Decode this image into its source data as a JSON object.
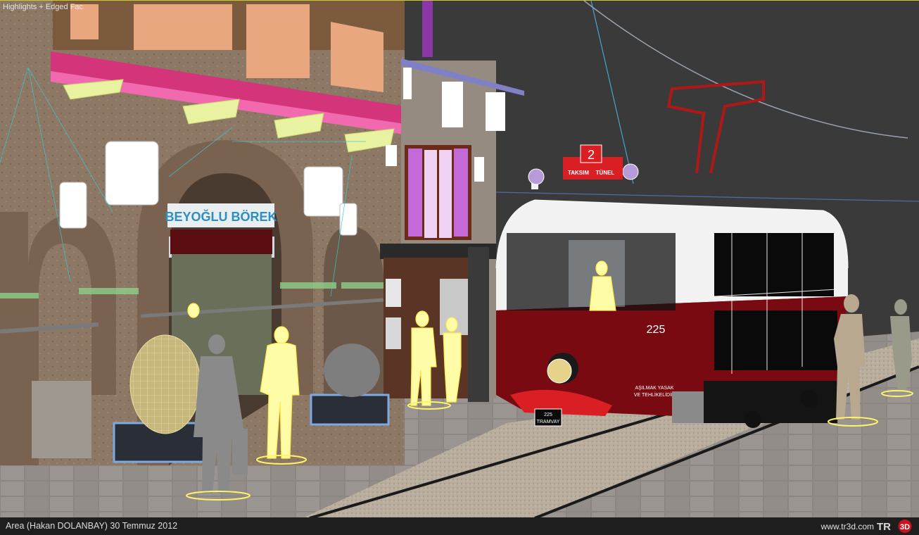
{
  "viewport": {
    "label": "Highlights + Edged Fac",
    "scene": {
      "shop_sign": "BEYOĞLU BÖREK",
      "tram_route_number": "2",
      "tram_destinations": [
        "TAKSIM",
        "TÜNEL"
      ],
      "tram_number": "225",
      "tram_front_plate": [
        "225",
        "TRAMVAY"
      ],
      "tram_warning": [
        "AŞILMAK YASAK",
        "VE TEHLİKELİDİR"
      ]
    },
    "colors": {
      "background": "#3a3a3a",
      "tram_body": "#7a0a12",
      "tram_roof": "#f2f2f2",
      "selection_yellow": "#fff36a",
      "wire_cyan": "#2ec4d8"
    }
  },
  "status_bar": {
    "caption": "Area (Hakan DOLANBAY)  30 Temmuz 2012",
    "website": "www.tr3d.com",
    "logo_text": "TR3D"
  }
}
